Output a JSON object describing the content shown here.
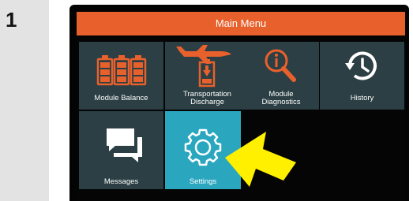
{
  "step": {
    "number": "1"
  },
  "screen": {
    "header": {
      "title": "Main Menu"
    },
    "tiles": [
      {
        "label": "Module Balance",
        "icon": "battery-modules-icon"
      },
      {
        "label": "Transportation Discharge",
        "label_line1": "Transportation",
        "label_line2": "Discharge",
        "icon": "plane-battery-discharge-icon"
      },
      {
        "label": "Module Diagnostics",
        "label_line1": "Module",
        "label_line2": "Diagnostics",
        "icon": "magnifier-info-icon"
      },
      {
        "label": "History",
        "icon": "history-clock-icon"
      },
      {
        "label": "Messages",
        "icon": "chat-bubbles-icon"
      },
      {
        "label": "Settings",
        "icon": "gear-icon",
        "selected": true
      }
    ]
  },
  "annotation": {
    "icon": "yellow-pointer-arrow-icon"
  },
  "colors": {
    "header": "#e8612c",
    "tile": "#2b3f44",
    "tile_selected": "#2aa7bf",
    "accent_orange": "#e8612c",
    "arrow": "#fff000"
  }
}
